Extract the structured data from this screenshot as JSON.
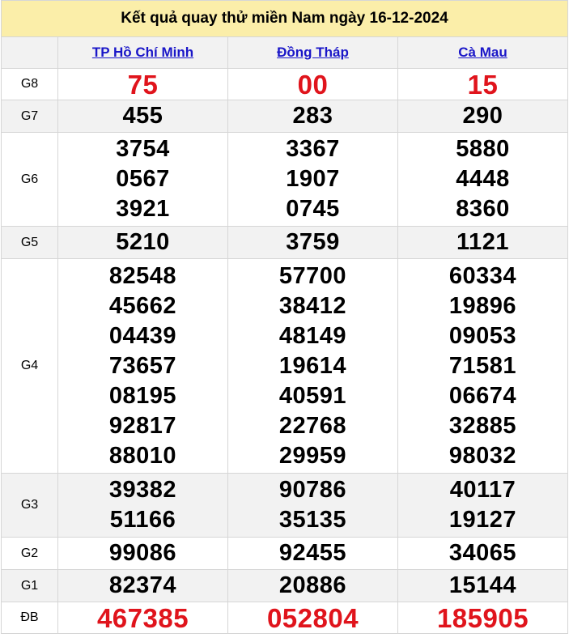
{
  "title": "Kết quả quay thử miền Nam ngày 16-12-2024",
  "provinces": [
    "TP Hồ Chí Minh",
    "Đồng Tháp",
    "Cà Mau"
  ],
  "prizes": {
    "G8": {
      "label": "G8",
      "values": [
        [
          "75"
        ],
        [
          "00"
        ],
        [
          "15"
        ]
      ]
    },
    "G7": {
      "label": "G7",
      "values": [
        [
          "455"
        ],
        [
          "283"
        ],
        [
          "290"
        ]
      ]
    },
    "G6": {
      "label": "G6",
      "values": [
        [
          "3754",
          "0567",
          "3921"
        ],
        [
          "3367",
          "1907",
          "0745"
        ],
        [
          "5880",
          "4448",
          "8360"
        ]
      ]
    },
    "G5": {
      "label": "G5",
      "values": [
        [
          "5210"
        ],
        [
          "3759"
        ],
        [
          "1121"
        ]
      ]
    },
    "G4": {
      "label": "G4",
      "values": [
        [
          "82548",
          "45662",
          "04439",
          "73657",
          "08195",
          "92817",
          "88010"
        ],
        [
          "57700",
          "38412",
          "48149",
          "19614",
          "40591",
          "22768",
          "29959"
        ],
        [
          "60334",
          "19896",
          "09053",
          "71581",
          "06674",
          "32885",
          "98032"
        ]
      ]
    },
    "G3": {
      "label": "G3",
      "values": [
        [
          "39382",
          "51166"
        ],
        [
          "90786",
          "35135"
        ],
        [
          "40117",
          "19127"
        ]
      ]
    },
    "G2": {
      "label": "G2",
      "values": [
        [
          "99086"
        ],
        [
          "92455"
        ],
        [
          "34065"
        ]
      ]
    },
    "G1": {
      "label": "G1",
      "values": [
        [
          "82374"
        ],
        [
          "20886"
        ],
        [
          "15144"
        ]
      ]
    },
    "DB": {
      "label": "ĐB",
      "values": [
        [
          "467385"
        ],
        [
          "052804"
        ],
        [
          "185905"
        ]
      ]
    }
  },
  "colors": {
    "title_bg": "#fbeea9",
    "link": "#1a16c8",
    "highlight": "#e0141c",
    "row_alt": "#f2f2f2"
  }
}
